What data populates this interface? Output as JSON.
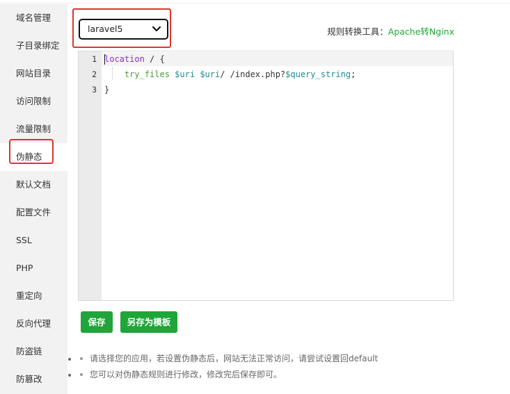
{
  "sidebar": {
    "items": [
      {
        "label": "域名管理"
      },
      {
        "label": "子目录绑定"
      },
      {
        "label": "网站目录"
      },
      {
        "label": "访问限制"
      },
      {
        "label": "流量限制"
      },
      {
        "label": "伪静态"
      },
      {
        "label": "默认文档"
      },
      {
        "label": "配置文件"
      },
      {
        "label": "SSL"
      },
      {
        "label": "PHP"
      },
      {
        "label": "重定向"
      },
      {
        "label": "反向代理"
      },
      {
        "label": "防盗链"
      },
      {
        "label": "防篡改"
      }
    ],
    "active_index": 5
  },
  "rewrite": {
    "selected_template": "laravel5",
    "converter_label": "规则转换工具：",
    "converter_link": "Apache转Nginx"
  },
  "editor": {
    "line_numbers": [
      "1",
      "2",
      "3"
    ],
    "lines": [
      [
        {
          "t": "location",
          "c": "kw"
        },
        {
          "t": " / {",
          "c": ""
        }
      ],
      [
        {
          "t": "    ",
          "c": ""
        },
        {
          "t": "try_files",
          "c": "fn"
        },
        {
          "t": " ",
          "c": ""
        },
        {
          "t": "$uri",
          "c": "var"
        },
        {
          "t": " ",
          "c": ""
        },
        {
          "t": "$uri",
          "c": "var"
        },
        {
          "t": "/ /index.php?",
          "c": ""
        },
        {
          "t": "$query_string",
          "c": "var"
        },
        {
          "t": ";",
          "c": ""
        }
      ],
      [
        {
          "t": "}",
          "c": ""
        }
      ]
    ]
  },
  "buttons": {
    "save": "保存",
    "save_as_template": "另存为模板"
  },
  "tips": [
    "请选择您的应用，若设置伪静态后，网站无法正常访问，请尝试设置回default",
    "您可以对伪静态规则进行修改，修改完后保存即可。"
  ],
  "colors": {
    "accent": "#20a53a",
    "highlight_border": "#e0332b",
    "sidebar_bg": "#f2f2f2"
  }
}
